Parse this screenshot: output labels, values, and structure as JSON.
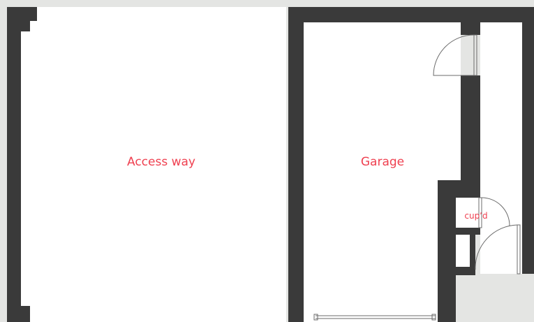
{
  "floorplan": {
    "colors": {
      "wall": "#3a3a3a",
      "floor": "#ffffff",
      "background": "#e4e5e3",
      "label": "#ef4050",
      "door_line": "#6b6b6b"
    },
    "rooms": [
      {
        "id": "access-way",
        "label": "Access way"
      },
      {
        "id": "garage",
        "label": "Garage"
      },
      {
        "id": "cupboard",
        "label": "cup’d"
      }
    ]
  }
}
